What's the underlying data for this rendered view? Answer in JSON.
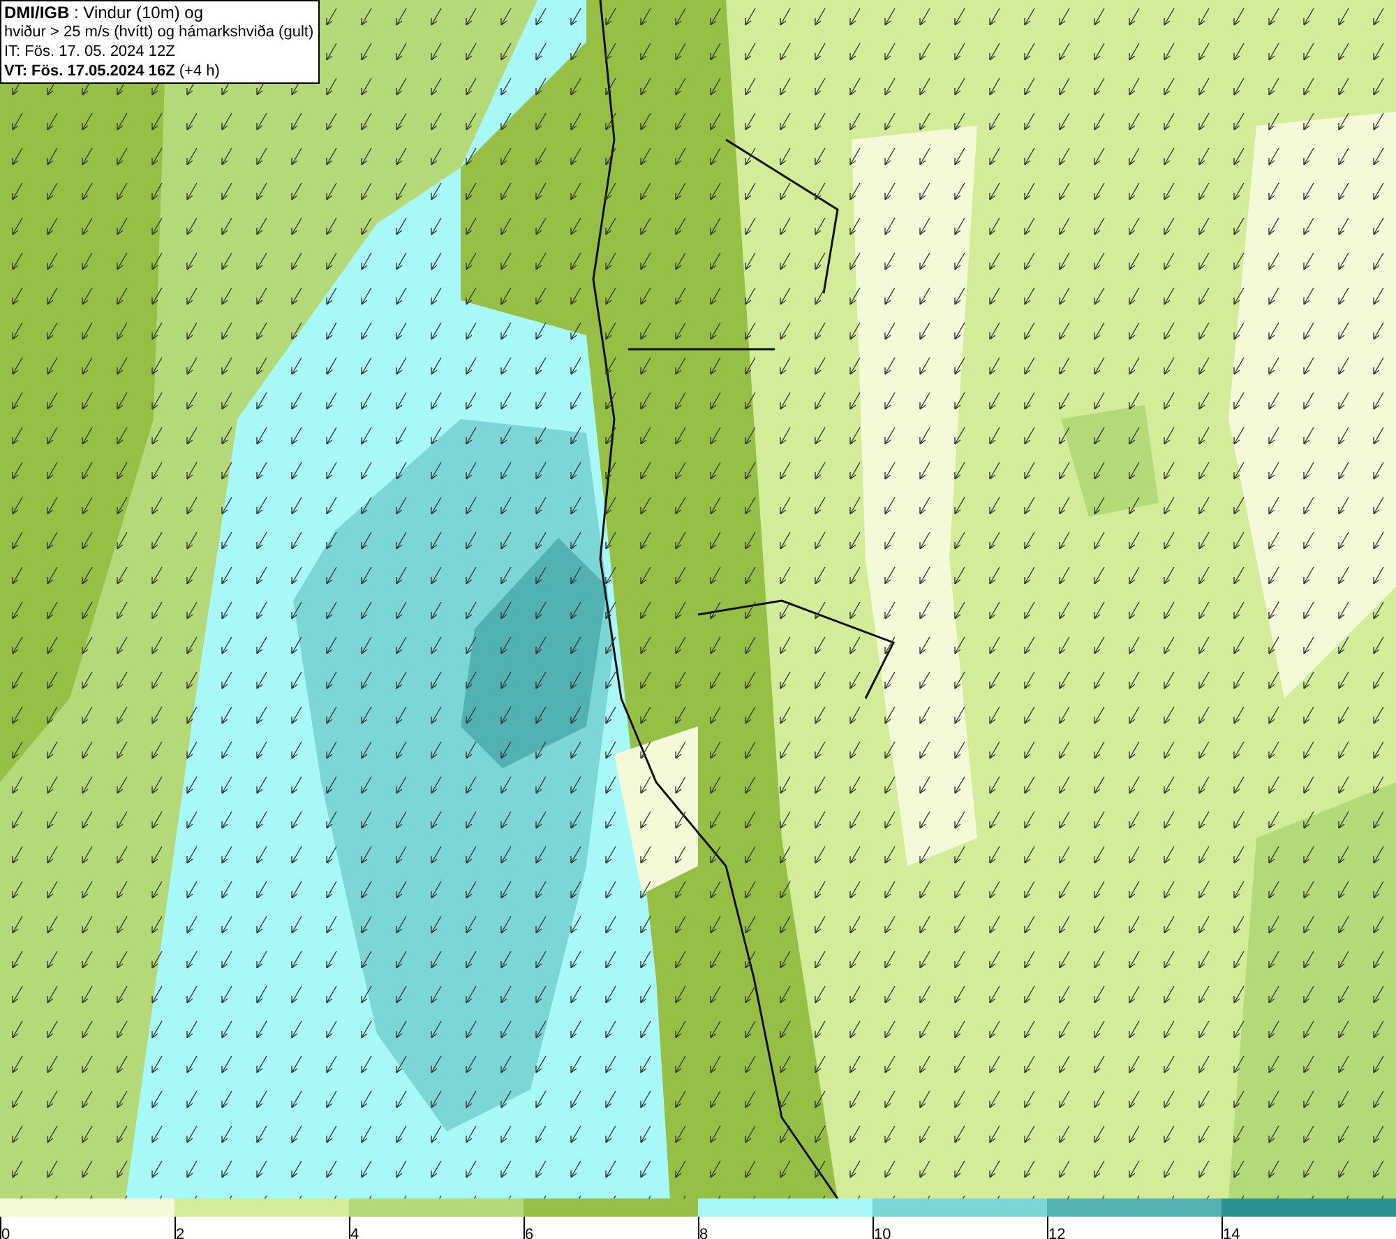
{
  "title_box": {
    "lines": [
      "**DMI/IGB** : Vindur (10m) og",
      "hviður > 25 m/s (hvítt) og hámarkshviða (gult)",
      "IT: Fös. 17. 05. 2024 12Z",
      "**VT: Fös. 17.05.2024 16Z** (+4 h)"
    ]
  },
  "legend": {
    "segments": [
      {
        "color": "#f4fad8"
      },
      {
        "color": "#d2ec9a"
      },
      {
        "color": "#b4d978"
      },
      {
        "color": "#95c045"
      },
      {
        "color": "#a8f8f8"
      },
      {
        "color": "#7dd6d6"
      },
      {
        "color": "#52b2b2"
      },
      {
        "color": "#2a9090"
      }
    ],
    "ticks": [
      "0",
      "2",
      "4",
      "6",
      "8",
      "10",
      "12",
      "14"
    ]
  }
}
